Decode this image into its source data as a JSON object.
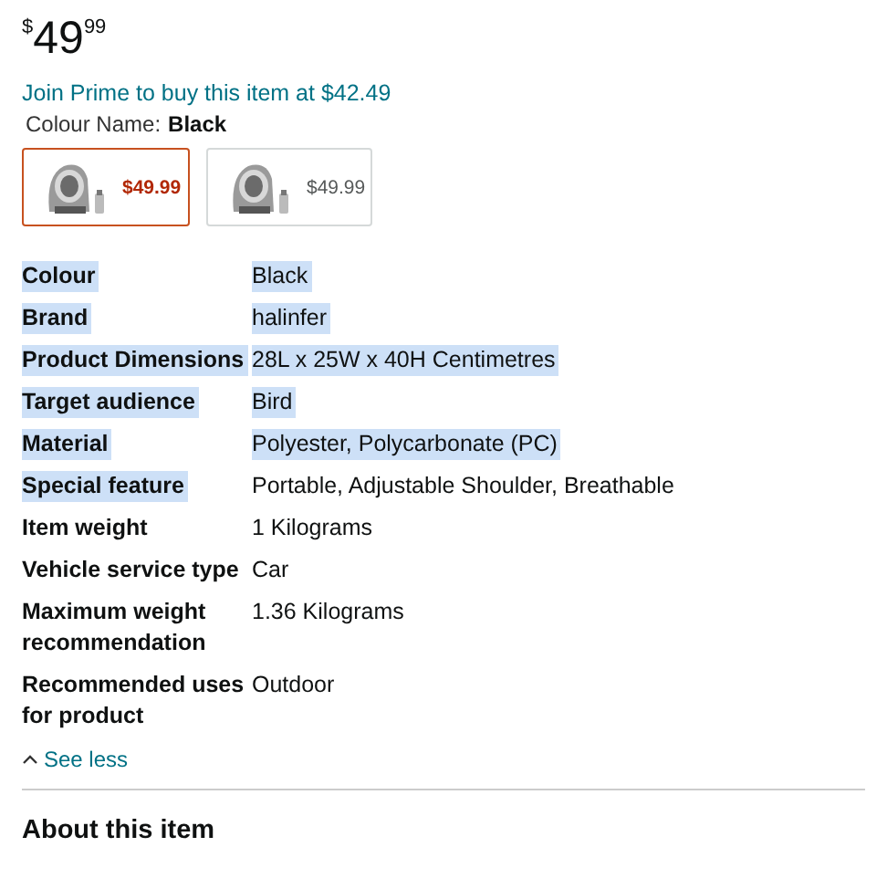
{
  "price": {
    "symbol": "$",
    "whole": "49",
    "fraction": "99"
  },
  "prime_offer": "Join Prime to buy this item at $42.49",
  "colour_name": {
    "label": "Colour Name:",
    "value": "Black"
  },
  "swatches": [
    {
      "price": "$49.99",
      "selected": true,
      "kind": "picture"
    },
    {
      "price": "$49.99",
      "selected": false,
      "kind": "picture"
    }
  ],
  "details": [
    {
      "label": "Colour",
      "value": "Black",
      "selected": true,
      "value_selected": true
    },
    {
      "label": "Brand",
      "value": "halinfer",
      "selected": true,
      "value_selected": true
    },
    {
      "label": "Product Dimensions",
      "value": "28L x 25W x 40H Centimetres",
      "selected": true,
      "value_selected": true
    },
    {
      "label": "Target audience",
      "value": "Bird",
      "selected": true,
      "value_selected": true
    },
    {
      "label": "Material",
      "value": "Polyester, Polycarbonate (PC)",
      "selected": true,
      "value_selected": true
    },
    {
      "label": "Special feature",
      "value": "Portable, Adjustable Shoulder, Breathable",
      "selected": true,
      "value_selected": false
    },
    {
      "label": "Item weight",
      "value": "1 Kilograms",
      "selected": false,
      "value_selected": false
    },
    {
      "label": "Vehicle service type",
      "value": "Car",
      "selected": false,
      "value_selected": false
    },
    {
      "label": "Maximum weight recommendation",
      "value": "1.36 Kilograms",
      "selected": false,
      "value_selected": false
    },
    {
      "label": "Recommended uses for product",
      "value": "Outdoor",
      "selected": false,
      "value_selected": false
    }
  ],
  "see_less": "See less",
  "section_title": "About this item"
}
